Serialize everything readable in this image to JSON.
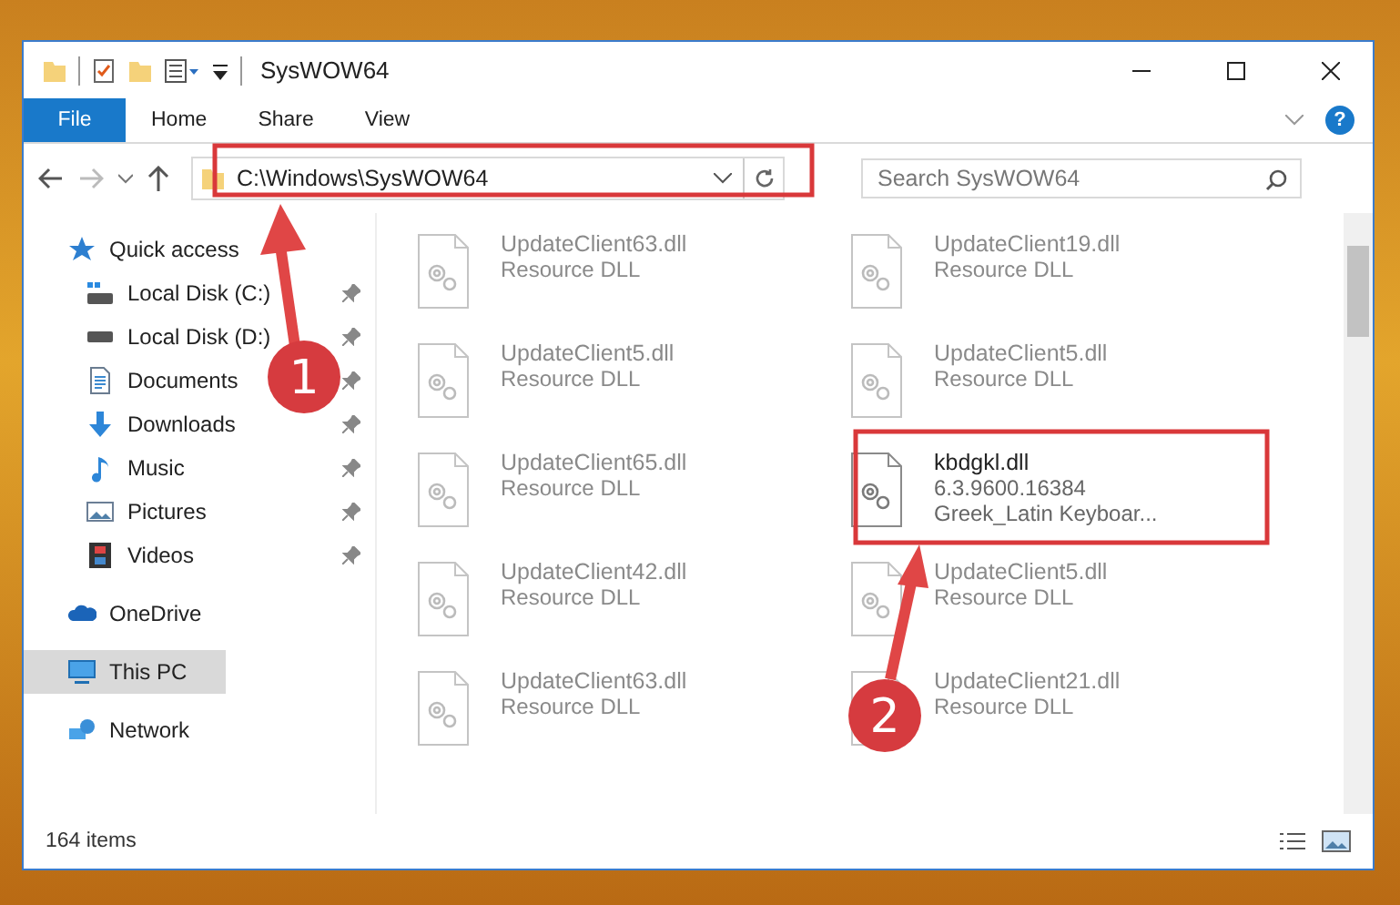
{
  "window": {
    "title": "SysWOW64"
  },
  "ribbon": {
    "tabs": [
      {
        "label": "File",
        "selected": true
      },
      {
        "label": "Home",
        "selected": false
      },
      {
        "label": "Share",
        "selected": false
      },
      {
        "label": "View",
        "selected": false
      }
    ],
    "help": "?"
  },
  "address": {
    "path": "C:\\Windows\\SysWOW64"
  },
  "search": {
    "placeholder": "Search SysWOW64"
  },
  "sidebar": {
    "items": [
      {
        "label": "Quick access",
        "kind": "star",
        "selected": false,
        "children": [
          {
            "label": "Local Disk (C:)",
            "kind": "system-drive",
            "pinned": true,
            "selected": false
          },
          {
            "label": "Local Disk (D:)",
            "kind": "drive",
            "pinned": true,
            "selected": false
          },
          {
            "label": "Documents",
            "kind": "documents",
            "pinned": true,
            "selected": false
          },
          {
            "label": "Downloads",
            "kind": "downloads",
            "pinned": true,
            "selected": false
          },
          {
            "label": "Music",
            "kind": "music",
            "pinned": true,
            "selected": false
          },
          {
            "label": "Pictures",
            "kind": "pictures",
            "pinned": true,
            "selected": false
          },
          {
            "label": "Videos",
            "kind": "videos",
            "pinned": true,
            "selected": false
          }
        ]
      },
      {
        "label": "OneDrive",
        "kind": "cloud",
        "selected": false
      },
      {
        "label": "This PC",
        "kind": "computer",
        "selected": true
      },
      {
        "label": "Network",
        "kind": "network",
        "selected": false
      }
    ]
  },
  "files": [
    {
      "name": "UpdateClient63.dll",
      "details": [
        "Resource DLL"
      ],
      "blurred": true
    },
    {
      "name": "UpdateClient19.dll",
      "details": [
        "Resource DLL"
      ],
      "blurred": true
    },
    {
      "name": "UpdateClient5.dll",
      "details": [
        "Resource DLL"
      ],
      "blurred": true
    },
    {
      "name": "UpdateClient5.dll",
      "details": [
        "Resource DLL"
      ],
      "blurred": true
    },
    {
      "name": "UpdateClient65.dll",
      "details": [
        "Resource DLL"
      ],
      "blurred": true
    },
    {
      "name": "kbdgkl.dll",
      "details": [
        "6.3.9600.16384",
        "Greek_Latin Keyboar..."
      ],
      "blurred": false
    },
    {
      "name": "UpdateClient42.dll",
      "details": [
        "Resource DLL"
      ],
      "blurred": true
    },
    {
      "name": "UpdateClient5.dll",
      "details": [
        "Resource DLL"
      ],
      "blurred": true
    },
    {
      "name": "UpdateClient63.dll",
      "details": [
        "Resource DLL"
      ],
      "blurred": true
    },
    {
      "name": "UpdateClient21.dll",
      "details": [
        "Resource DLL"
      ],
      "blurred": true
    }
  ],
  "status_bar": {
    "count": "164 items"
  },
  "annotations": [
    {
      "label": "1"
    },
    {
      "label": "2"
    }
  ]
}
